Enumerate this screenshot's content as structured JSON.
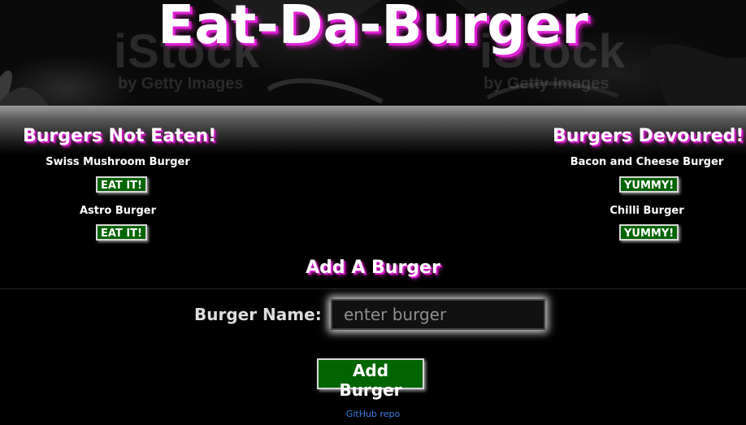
{
  "app": {
    "title": "Eat-Da-Burger"
  },
  "banner_watermark": {
    "left_big": "iStock",
    "left_small": "by Getty Images",
    "right_big": "iStock",
    "right_small": "by Getty Images"
  },
  "not_eaten": {
    "heading": "Burgers Not Eaten!",
    "items": [
      {
        "name": "Swiss Mushroom Burger",
        "button": "EAT IT!"
      },
      {
        "name": "Astro Burger",
        "button": "EAT IT!"
      }
    ]
  },
  "devoured": {
    "heading": "Burgers Devoured!",
    "items": [
      {
        "name": "Bacon and Cheese Burger",
        "button": "YUMMY!"
      },
      {
        "name": "Chilli Burger",
        "button": "YUMMY!"
      }
    ]
  },
  "add_form": {
    "heading": "Add A Burger",
    "label": "Burger Name:",
    "placeholder": "enter burger",
    "value": "",
    "submit": "Add Burger"
  },
  "footer": {
    "link": "GitHub repo"
  },
  "colors": {
    "accent_shadow": "#e21fd8",
    "button_bg": "#006400",
    "link": "#3b7ce6"
  }
}
